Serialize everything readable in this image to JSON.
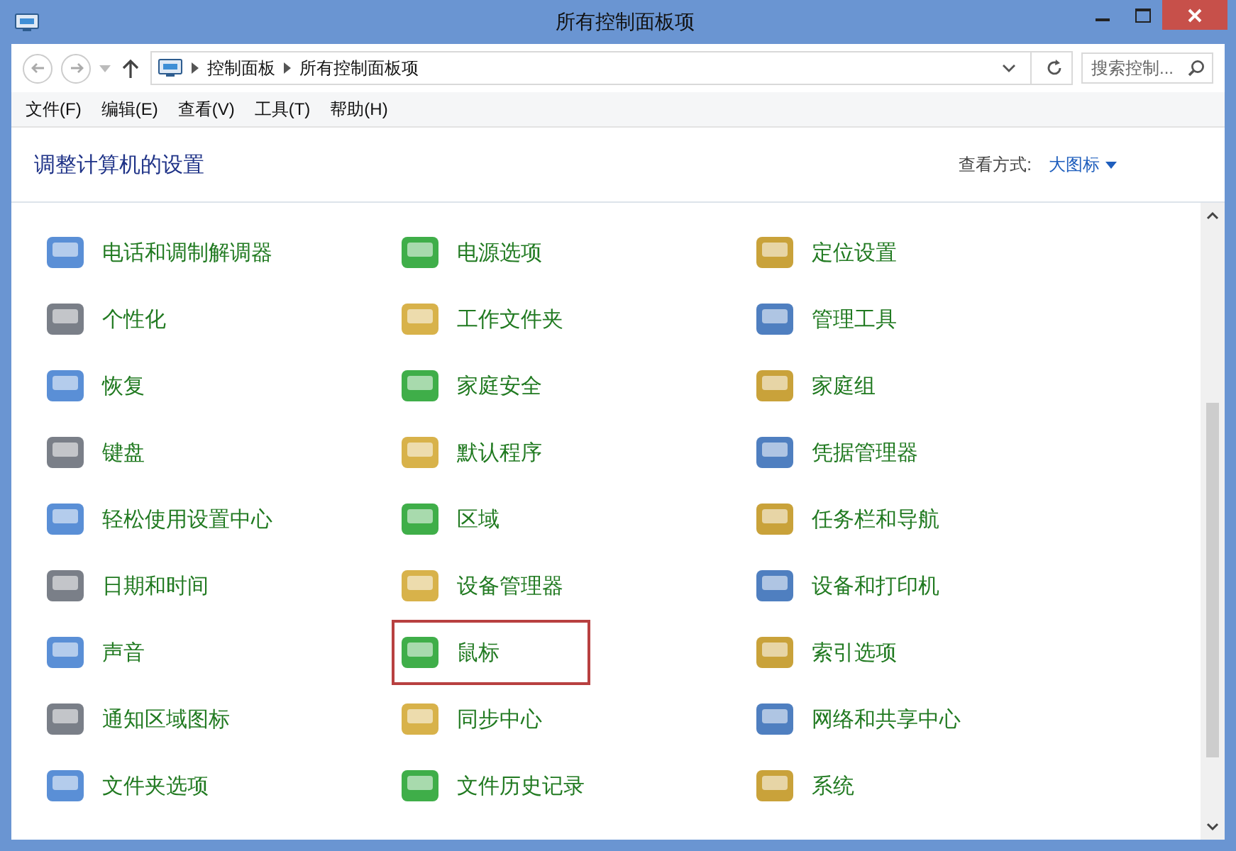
{
  "window": {
    "title": "所有控制面板项"
  },
  "address_bar": {
    "path": [
      "控制面板",
      "所有控制面板项"
    ]
  },
  "search": {
    "placeholder": "搜索控制..."
  },
  "menu": [
    "文件(F)",
    "编辑(E)",
    "查看(V)",
    "工具(T)",
    "帮助(H)"
  ],
  "header": {
    "title": "调整计算机的设置",
    "view_label": "查看方式:",
    "view_value": "大图标"
  },
  "items": [
    {
      "label": "电话和调制解调器",
      "highlighted": false
    },
    {
      "label": "电源选项",
      "highlighted": false
    },
    {
      "label": "定位设置",
      "highlighted": false
    },
    {
      "label": "个性化",
      "highlighted": false
    },
    {
      "label": "工作文件夹",
      "highlighted": false
    },
    {
      "label": "管理工具",
      "highlighted": false
    },
    {
      "label": "恢复",
      "highlighted": false
    },
    {
      "label": "家庭安全",
      "highlighted": false
    },
    {
      "label": "家庭组",
      "highlighted": false
    },
    {
      "label": "键盘",
      "highlighted": false
    },
    {
      "label": "默认程序",
      "highlighted": false
    },
    {
      "label": "凭据管理器",
      "highlighted": false
    },
    {
      "label": "轻松使用设置中心",
      "highlighted": false
    },
    {
      "label": "区域",
      "highlighted": false
    },
    {
      "label": "任务栏和导航",
      "highlighted": false
    },
    {
      "label": "日期和时间",
      "highlighted": false
    },
    {
      "label": "设备管理器",
      "highlighted": false
    },
    {
      "label": "设备和打印机",
      "highlighted": false
    },
    {
      "label": "声音",
      "highlighted": false
    },
    {
      "label": "鼠标",
      "highlighted": true
    },
    {
      "label": "索引选项",
      "highlighted": false
    },
    {
      "label": "通知区域图标",
      "highlighted": false
    },
    {
      "label": "同步中心",
      "highlighted": false
    },
    {
      "label": "网络和共享中心",
      "highlighted": false
    },
    {
      "label": "文件夹选项",
      "highlighted": false
    },
    {
      "label": "文件历史记录",
      "highlighted": false
    },
    {
      "label": "系统",
      "highlighted": false
    }
  ]
}
